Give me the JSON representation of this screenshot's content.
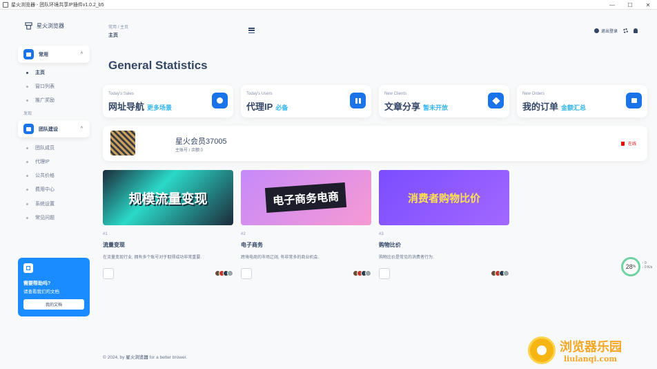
{
  "window": {
    "title": "星火浏览器 - 团队环境共享IP插件v1.0.2_b5",
    "controls": [
      "—",
      "☐",
      "✕"
    ]
  },
  "sidebar": {
    "brand": "星火浏览器",
    "section1": {
      "label": "常用",
      "chevron": "^"
    },
    "items1": [
      {
        "label": "主页",
        "active": true
      },
      {
        "label": "窗口列表"
      },
      {
        "label": "推广奖励"
      }
    ],
    "section_caption": "发现",
    "section2": {
      "label": "团队建设",
      "chevron": "^"
    },
    "items2": [
      {
        "label": "团队成员"
      },
      {
        "label": "代理IP"
      },
      {
        "label": "公共价格"
      },
      {
        "label": "费用中心"
      },
      {
        "label": "系统设置"
      },
      {
        "label": "常见问题"
      }
    ],
    "help": {
      "title": "需要帮助吗?",
      "subtitle": "请查看我们的文档",
      "button": "我的文档"
    }
  },
  "topbar": {
    "breadcrumb_root": "常用",
    "breadcrumb_sep": "/",
    "breadcrumb_current": "主页",
    "page_title": "主页",
    "logout": "退出登录"
  },
  "main": {
    "heading": "General Statistics",
    "stats": [
      {
        "label": "Today's Sales",
        "value": "网址导航",
        "extra": "更多场景",
        "icon": "dollar-icon"
      },
      {
        "label": "Today's Users",
        "value": "代理IP",
        "extra": "必备",
        "icon": "grid-icon"
      },
      {
        "label": "New Clients",
        "value": "文章分享",
        "extra": "暂未开放",
        "icon": "heart-icon"
      },
      {
        "label": "New Orders",
        "value": "我的订单",
        "extra": "金额汇总",
        "icon": "bag-icon"
      }
    ],
    "member": {
      "name": "星火会员37005",
      "sub": "主账号 / 余额:0",
      "status": "在线"
    },
    "projects": [
      {
        "num": "#1",
        "title": "流量变现",
        "desc": "在流量变现行业, 拥有多个账号对于取得成功非常重要.",
        "banner_text": "规模流量变现",
        "bg1": "#2bd9c8",
        "bg2": "#1c2b3a"
      },
      {
        "num": "#2",
        "title": "电子商务",
        "desc": "跨境电商的市场辽阔, 有非常多的商业机会.",
        "banner_text": "电子商务电商",
        "bg1": "#c58af9",
        "bg2": "#f79ad3"
      },
      {
        "num": "#3",
        "title": "购物比价",
        "desc": "购物比价是常见的消费者行为.",
        "banner_text": "消费者购物比价",
        "bg1": "#7b4dff",
        "bg2": "#a268ff"
      }
    ],
    "avatar_colors": [
      "#6b4f3a",
      "#c0392b",
      "#2c3e50",
      "#95a5a6"
    ]
  },
  "footer": {
    "prefix": "© 2024, by",
    "brand": "星火浏览器",
    "suffix": "for a better brower."
  },
  "widget": {
    "value": "28",
    "unit": "%",
    "side_top": "↑ 0",
    "side_bottom": "↓ 0 K/s"
  },
  "watermark": {
    "title": "浏览器乐园",
    "url": "liulanqi.com"
  },
  "colors": {
    "accent": "#1a73e8",
    "text": "#344767",
    "highlight": "#34b7f1",
    "danger": "#ea0606"
  }
}
